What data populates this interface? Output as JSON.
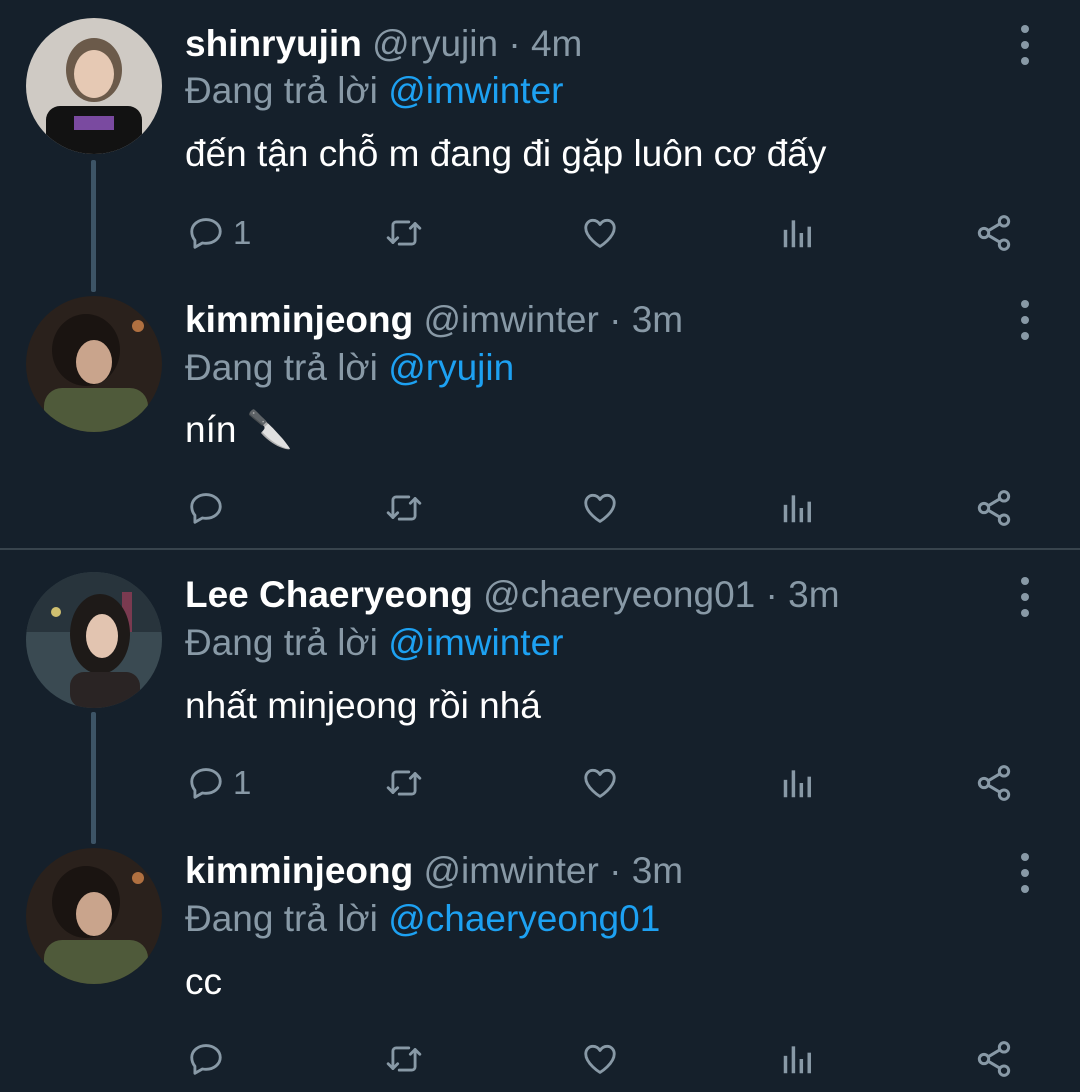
{
  "colors": {
    "background": "#15202b",
    "primary_text": "#ffffff",
    "secondary_text": "#8899a6",
    "accent": "#1da1f2",
    "thread_line": "#3d5466",
    "divider": "#38444d"
  },
  "icons": {
    "reply": "reply-icon",
    "retweet": "retweet-icon",
    "like": "heart-icon",
    "analytics": "analytics-icon",
    "share": "share-icon",
    "more": "more-vertical-icon"
  },
  "tweets": [
    {
      "name": "shinryujin",
      "handle": "@ryujin",
      "separator": "·",
      "time": "4m",
      "replying_prefix": "Đang trả lời",
      "replying_to": "@imwinter",
      "text": "đến tận chỗ m đang đi gặp luôn cơ đấy",
      "reply_count": "1"
    },
    {
      "name": "kimminjeong",
      "handle": "@imwinter",
      "separator": "·",
      "time": "3m",
      "replying_prefix": "Đang trả lời",
      "replying_to": "@ryujin",
      "text": "nín 🔪",
      "reply_count": ""
    },
    {
      "name": "Lee Chaeryeong",
      "handle": "@chaeryeong01",
      "separator": "·",
      "time": "3m",
      "replying_prefix": "Đang trả lời",
      "replying_to": "@imwinter",
      "text": "nhất minjeong rồi nhá",
      "reply_count": "1"
    },
    {
      "name": "kimminjeong",
      "handle": "@imwinter",
      "separator": "·",
      "time": "3m",
      "replying_prefix": "Đang trả lời",
      "replying_to": "@chaeryeong01",
      "text": "cc",
      "reply_count": ""
    }
  ]
}
